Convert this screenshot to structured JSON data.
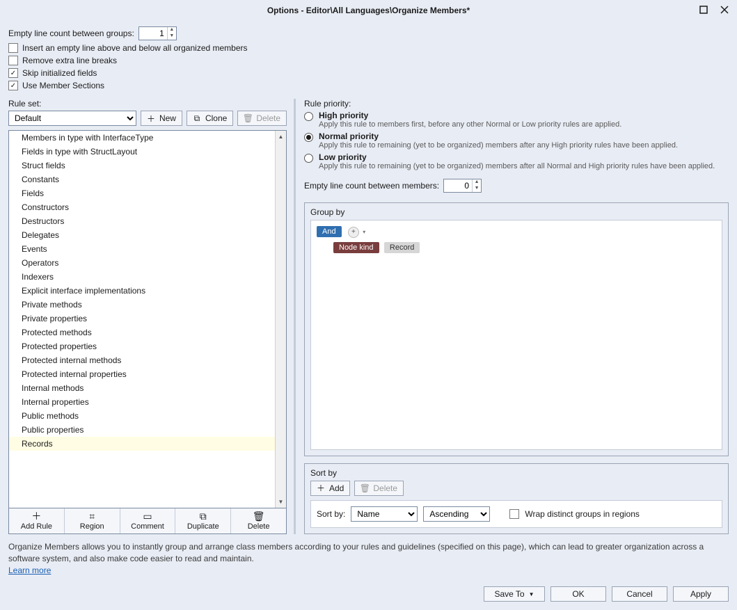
{
  "window": {
    "title": "Options - Editor\\All Languages\\Organize Members*"
  },
  "top": {
    "emptyLineLabel": "Empty line count between groups:",
    "emptyLineValue": "1",
    "opt_insert": "Insert an empty line above and below all organized members",
    "opt_remove": "Remove extra line breaks",
    "opt_skip": "Skip initialized fields",
    "opt_use": "Use Member Sections"
  },
  "left": {
    "ruleSetLabel": "Rule set:",
    "ruleSetValue": "Default",
    "newBtn": "New",
    "cloneBtn": "Clone",
    "deleteBtn": "Delete",
    "items": [
      "Members in type with InterfaceType",
      "Fields in type with StructLayout",
      "Struct fields",
      "Constants",
      "Fields",
      "Constructors",
      "Destructors",
      "Delegates",
      "Events",
      "Operators",
      "Indexers",
      "Explicit interface implementations",
      "Private methods",
      "Private properties",
      "Protected methods",
      "Protected properties",
      "Protected internal methods",
      "Protected internal properties",
      "Internal methods",
      "Internal properties",
      "Public methods",
      "Public properties",
      "Records"
    ],
    "toolbar": {
      "addRule": "Add Rule",
      "region": "Region",
      "comment": "Comment",
      "duplicate": "Duplicate",
      "delete": "Delete"
    }
  },
  "right": {
    "rulePriorityLabel": "Rule priority:",
    "high": {
      "title": "High priority",
      "desc": "Apply this rule to members first, before any other Normal or Low priority rules are applied."
    },
    "normal": {
      "title": "Normal priority",
      "desc": "Apply this rule to remaining (yet to be organized) members after any High priority rules have been applied."
    },
    "low": {
      "title": "Low priority",
      "desc": "Apply this rule to remaining (yet to be organized) members after all Normal and High priority rules have been applied."
    },
    "emptyMembersLabel": "Empty line count between members:",
    "emptyMembersValue": "0",
    "groupByTitle": "Group by",
    "andTag": "And",
    "nodeKindTag": "Node kind",
    "recordTag": "Record",
    "sortByTitle": "Sort by",
    "addBtn": "Add",
    "deleteBtn": "Delete",
    "sortByLabel": "Sort by:",
    "sortField": "Name",
    "sortDir": "Ascending",
    "wrapLabel": "Wrap distinct groups in regions"
  },
  "footer": {
    "desc": "Organize Members allows you to instantly group and arrange class members according to your rules and guidelines (specified on this page), which can lead to greater organization across a software system, and also make code easier to read and maintain.",
    "learnMore": "Learn more"
  },
  "buttons": {
    "saveTo": "Save To",
    "ok": "OK",
    "cancel": "Cancel",
    "apply": "Apply"
  }
}
